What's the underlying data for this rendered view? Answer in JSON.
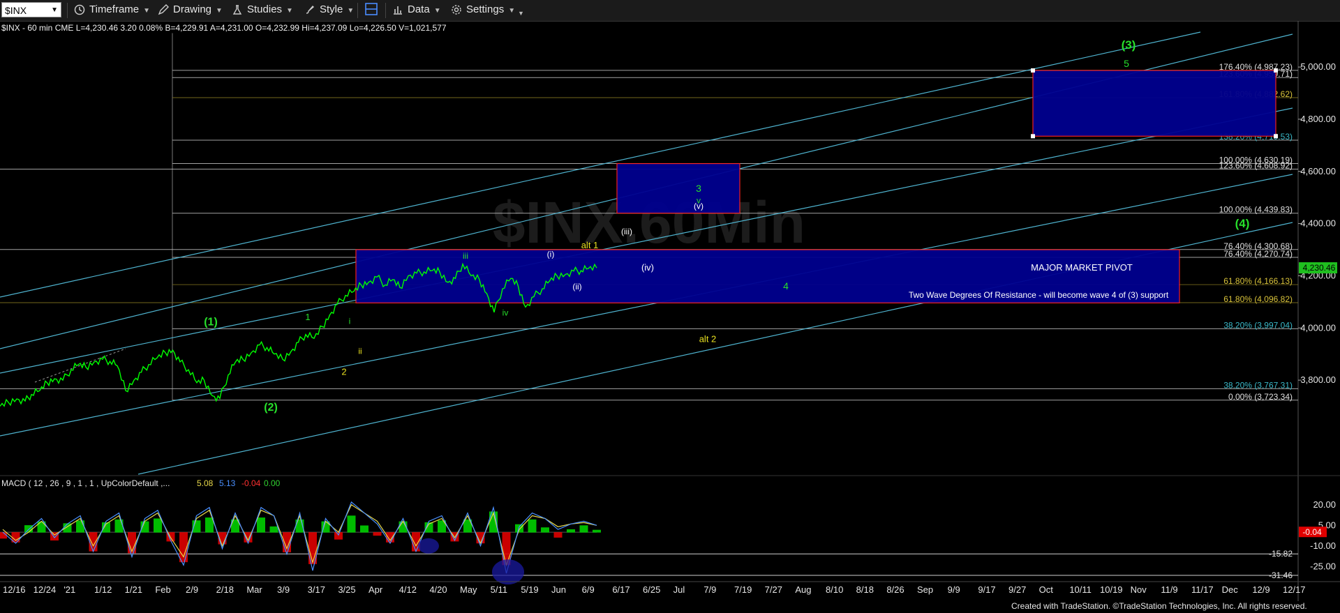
{
  "toolbar": {
    "symbol": "$INX",
    "timeframe": "Timeframe",
    "drawing": "Drawing",
    "studies": "Studies",
    "style": "Style",
    "data": "Data",
    "settings": "Settings"
  },
  "colors": {
    "background": "#000000",
    "price": "#00ff00",
    "channel": "#4fb4d0",
    "fib_line": "#cfcfcf",
    "box_fill": "#00008f",
    "box_border": "#ff2222",
    "wave_green": "#27e02b",
    "wave_yellow": "#e8e020",
    "wave_white": "#ffffff",
    "macd_line": "#4a90ff",
    "signal_line": "#e8d84a",
    "hist_pos": "#00d000",
    "hist_neg": "#e00000"
  },
  "footer": "Created with TradeStation. ©TradeStation Technologies, Inc. All rights reserved.",
  "chart_data": {
    "type": "line",
    "header": "$INX - 60 min  CME  L=4,230.46  3.20  0.08%  B=4,229.91  A=4,231.00  O=4,232.99  Hi=4,237.09  Lo=4,226.50  V=1,021,577",
    "watermark": "$INX.60Min",
    "last_price": "4,230.46",
    "x_tick_labels": [
      "12/16",
      "12/24",
      "'21",
      "1/12",
      "1/21",
      "Feb",
      "2/9",
      "2/18",
      "Mar",
      "3/9",
      "3/17",
      "3/25",
      "Apr",
      "4/12",
      "4/20",
      "May",
      "5/11",
      "5/19",
      "Jun",
      "6/9",
      "6/17",
      "6/25",
      "Jul",
      "7/9",
      "7/19",
      "7/27",
      "Aug",
      "8/10",
      "8/18",
      "8/26",
      "Sep",
      "9/9",
      "9/17",
      "9/27",
      "Oct",
      "10/11",
      "10/19",
      "Nov",
      "11/9",
      "11/17",
      "Dec",
      "12/9",
      "12/17"
    ],
    "y_ticks": [
      3800,
      4000,
      4200,
      4400,
      4600,
      4800,
      5000
    ],
    "y_tick_labels": [
      "3,800.00",
      "4,000.00",
      "4,200.00",
      "4,400.00",
      "4,600.00",
      "4,800.00",
      "5,000.00"
    ],
    "ylim": [
      3680,
      5150
    ],
    "price_series": {
      "name": "$INX",
      "x": [
        0,
        8,
        16,
        24,
        30,
        38,
        45,
        52,
        60,
        68,
        75,
        82,
        90,
        98,
        105,
        112,
        120,
        128,
        135,
        142,
        150,
        158,
        165,
        172,
        180,
        188,
        195,
        203,
        210,
        218,
        225,
        232,
        240,
        248,
        255,
        262,
        270,
        278,
        285,
        292,
        300,
        308,
        315,
        322,
        330,
        338,
        345,
        352,
        360,
        368,
        375,
        382,
        390,
        398,
        405,
        413,
        420,
        428,
        435,
        442,
        450,
        458,
        465,
        472,
        480,
        488,
        495,
        502,
        510,
        518,
        525,
        532,
        540,
        548,
        555,
        562,
        570
      ],
      "y": [
        3700,
        3715,
        3728,
        3720,
        3745,
        3760,
        3790,
        3805,
        3800,
        3840,
        3860,
        3850,
        3870,
        3880,
        3872,
        3855,
        3760,
        3800,
        3830,
        3860,
        3885,
        3905,
        3915,
        3870,
        3840,
        3790,
        3800,
        3740,
        3730,
        3820,
        3870,
        3880,
        3905,
        3935,
        3925,
        3900,
        3880,
        3910,
        3945,
        3975,
        3960,
        4005,
        4050,
        4090,
        4125,
        4140,
        4165,
        4175,
        4195,
        4165,
        4185,
        4155,
        4200,
        4210,
        4215,
        4220,
        4215,
        4175,
        4190,
        4245,
        4200,
        4185,
        4132,
        4060,
        4150,
        4190,
        4160,
        4080,
        4120,
        4150,
        4180,
        4200,
        4205,
        4218,
        4220,
        4228,
        4230
      ]
    },
    "price_series_dates": "Dec 2020 - Jun 2021, 60-minute bars",
    "fib_levels": [
      {
        "label": "176.40% (4,987.23)",
        "value": 4987.23
      },
      {
        "label": "123.60% (4,959.71)",
        "value": 4959.71
      },
      {
        "label": "161.80% (4,882.62)",
        "value": 4882.62
      },
      {
        "label": "138.20% (4,719.53)",
        "value": 4719.53
      },
      {
        "label": "100.00% (4,630.19)",
        "value": 4630.19
      },
      {
        "label": "123.60% (4,608.92)",
        "value": 4608.92
      },
      {
        "label": "100.00% (4,439.83)",
        "value": 4439.83
      },
      {
        "label": "76.40% (4,300.68)",
        "value": 4300.68
      },
      {
        "label": "76.40% (4,270.74)",
        "value": 4270.74
      },
      {
        "label": "61.80% (4,166.13)",
        "value": 4166.13
      },
      {
        "label": "61.80% (4,096.82)",
        "value": 4096.82
      },
      {
        "label": "38.20% (3,997.04)",
        "value": 3997.04
      },
      {
        "label": "38.20% (3,767.31)",
        "value": 3767.31
      },
      {
        "label": "0.00% (3,723.34)",
        "value": 3723.34
      }
    ],
    "boxes": [
      {
        "name": "major-pivot",
        "label": "MAJOR MARKET PIVOT",
        "sublabel": "Two Wave Degrees Of Resistance - will become wave 4 of (3) support",
        "top": 4300,
        "bottom": 4096
      },
      {
        "name": "wave-3-target",
        "label": "",
        "top": 4630,
        "bottom": 4440
      },
      {
        "name": "wave-3-major-target",
        "label": "",
        "top": 4987,
        "bottom": 4735
      }
    ],
    "wave_labels": [
      {
        "text": "(1)",
        "color": "green"
      },
      {
        "text": "(2)",
        "color": "green"
      },
      {
        "text": "1",
        "color": "green"
      },
      {
        "text": "2",
        "color": "yellow"
      },
      {
        "text": "i",
        "color": "green"
      },
      {
        "text": "ii",
        "color": "yellow"
      },
      {
        "text": "iii",
        "color": "green"
      },
      {
        "text": "iv",
        "color": "green"
      },
      {
        "text": "(i)",
        "color": "white"
      },
      {
        "text": "(ii)",
        "color": "white"
      },
      {
        "text": "(iii)",
        "color": "white"
      },
      {
        "text": "(iv)",
        "color": "white"
      },
      {
        "text": "(v)",
        "color": "white"
      },
      {
        "text": "v",
        "color": "green"
      },
      {
        "text": "3",
        "color": "green"
      },
      {
        "text": "4",
        "color": "green"
      },
      {
        "text": "5",
        "color": "green"
      },
      {
        "text": "(3)",
        "color": "green"
      },
      {
        "text": "(4)",
        "color": "green"
      },
      {
        "text": "alt 1",
        "color": "yellow"
      },
      {
        "text": "alt 2",
        "color": "yellow"
      }
    ],
    "macd": {
      "header": "MACD ( 12 , 26 , 9 , 1 , 1 , UpColorDefault ,...",
      "values_text": [
        "5.08",
        "5.13",
        "-0.04",
        "0.00"
      ],
      "value_colors": [
        "#e8d84a",
        "#4a90ff",
        "#ff3030",
        "#30d030"
      ],
      "ylim": [
        -34,
        26
      ],
      "y_tick_labels": [
        "20.00",
        "5.00",
        "-10.00",
        "-25.00"
      ],
      "y_ticks": [
        20,
        5,
        -10,
        -25
      ],
      "levels": [
        {
          "label": "-15.82",
          "value": -15.82
        },
        {
          "label": "-31.46",
          "value": -31.46
        }
      ],
      "last_value_label": "-0.04",
      "macd_line": [
        0,
        -8,
        2,
        10,
        -4,
        6,
        12,
        -14,
        8,
        14,
        -18,
        10,
        16,
        -6,
        -24,
        12,
        18,
        -12,
        14,
        -8,
        18,
        12,
        -16,
        14,
        -28,
        10,
        -2,
        22,
        14,
        6,
        -8,
        10,
        -14,
        8,
        12,
        -6,
        14,
        -10,
        18,
        -30,
        4,
        14,
        10,
        2,
        6,
        8,
        5
      ],
      "signal_line": [
        2,
        -6,
        0,
        8,
        -2,
        4,
        10,
        -10,
        6,
        12,
        -14,
        8,
        14,
        -4,
        -18,
        10,
        16,
        -10,
        12,
        -6,
        16,
        12,
        -12,
        12,
        -22,
        8,
        0,
        20,
        14,
        8,
        -6,
        8,
        -10,
        6,
        10,
        -4,
        12,
        -8,
        14,
        -24,
        2,
        12,
        10,
        4,
        6,
        7,
        5
      ]
    }
  }
}
